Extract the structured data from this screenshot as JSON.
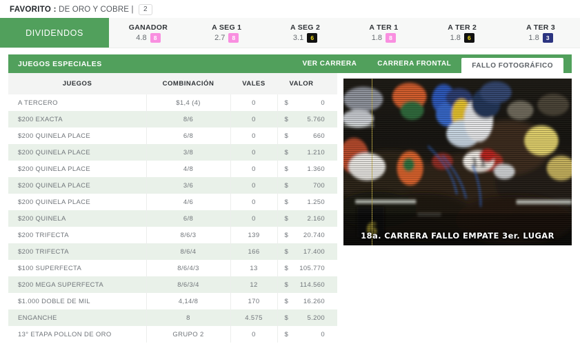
{
  "favorite": {
    "label": "FAVORITO :",
    "name": "DE ORO Y COBRE |",
    "number": "2"
  },
  "odds_tabs": {
    "active_label": "DIVIDENDOS",
    "items": [
      {
        "name": "GANADOR",
        "value": "4.8",
        "badge": "8",
        "badge_bg": "#f98fe0",
        "badge_fg": "#ffffff"
      },
      {
        "name": "A SEG 1",
        "value": "2.7",
        "badge": "8",
        "badge_bg": "#f98fe0",
        "badge_fg": "#ffffff"
      },
      {
        "name": "A SEG 2",
        "value": "3.1",
        "badge": "6",
        "badge_bg": "#111111",
        "badge_fg": "#f5e11a"
      },
      {
        "name": "A TER 1",
        "value": "1.8",
        "badge": "8",
        "badge_bg": "#f98fe0",
        "badge_fg": "#ffffff"
      },
      {
        "name": "A TER 2",
        "value": "1.8",
        "badge": "6",
        "badge_bg": "#111111",
        "badge_fg": "#f5e11a"
      },
      {
        "name": "A TER 3",
        "value": "1.8",
        "badge": "3",
        "badge_bg": "#2b3480",
        "badge_fg": "#ffffff"
      }
    ]
  },
  "section": {
    "title": "JUEGOS ESPECIALES",
    "tabs": [
      {
        "label": "VER CARRERA",
        "active": false
      },
      {
        "label": "CARRERA FRONTAL",
        "active": false
      },
      {
        "label": "FALLO FOTOGRÁFICO",
        "active": true
      }
    ]
  },
  "table": {
    "headers": [
      "JUEGOS",
      "COMBINACIÓN",
      "VALES",
      "VALOR"
    ],
    "currency": "$",
    "rows": [
      {
        "juego": "A TERCERO",
        "combinacion": "$1,4 (4)",
        "vales": "0",
        "valor": "0"
      },
      {
        "juego": "$200 EXACTA",
        "combinacion": "8/6",
        "vales": "0",
        "valor": "5.760"
      },
      {
        "juego": "$200 QUINELA PLACE",
        "combinacion": "6/8",
        "vales": "0",
        "valor": "660"
      },
      {
        "juego": "$200 QUINELA PLACE",
        "combinacion": "3/8",
        "vales": "0",
        "valor": "1.210"
      },
      {
        "juego": "$200 QUINELA PLACE",
        "combinacion": "4/8",
        "vales": "0",
        "valor": "1.360"
      },
      {
        "juego": "$200 QUINELA PLACE",
        "combinacion": "3/6",
        "vales": "0",
        "valor": "700"
      },
      {
        "juego": "$200 QUINELA PLACE",
        "combinacion": "4/6",
        "vales": "0",
        "valor": "1.250"
      },
      {
        "juego": "$200 QUINELA",
        "combinacion": "6/8",
        "vales": "0",
        "valor": "2.160"
      },
      {
        "juego": "$200 TRIFECTA",
        "combinacion": "8/6/3",
        "vales": "139",
        "valor": "20.740"
      },
      {
        "juego": "$200 TRIFECTA",
        "combinacion": "8/6/4",
        "vales": "166",
        "valor": "17.400"
      },
      {
        "juego": "$100 SUPERFECTA",
        "combinacion": "8/6/4/3",
        "vales": "13",
        "valor": "105.770"
      },
      {
        "juego": "$200 MEGA SUPERFECTA",
        "combinacion": "8/6/3/4",
        "vales": "12",
        "valor": "114.560"
      },
      {
        "juego": "$1.000 DOBLE DE MIL",
        "combinacion": "4,14/8",
        "vales": "170",
        "valor": "16.260"
      },
      {
        "juego": "ENGANCHE",
        "combinacion": "8",
        "vales": "4.575",
        "valor": "5.200"
      },
      {
        "juego": "13° ETAPA POLLON DE ORO",
        "combinacion": "GRUPO 2",
        "vales": "0",
        "valor": "0"
      }
    ]
  },
  "photo_finish": {
    "caption": "18a. CARRERA   FALLO EMPATE 3er. LUGAR",
    "alt": "photo-finish-image"
  },
  "colors": {
    "brand_green": "#51a05c",
    "row_alt": "#e9f1e9",
    "header_gray": "#f3f4f3"
  }
}
